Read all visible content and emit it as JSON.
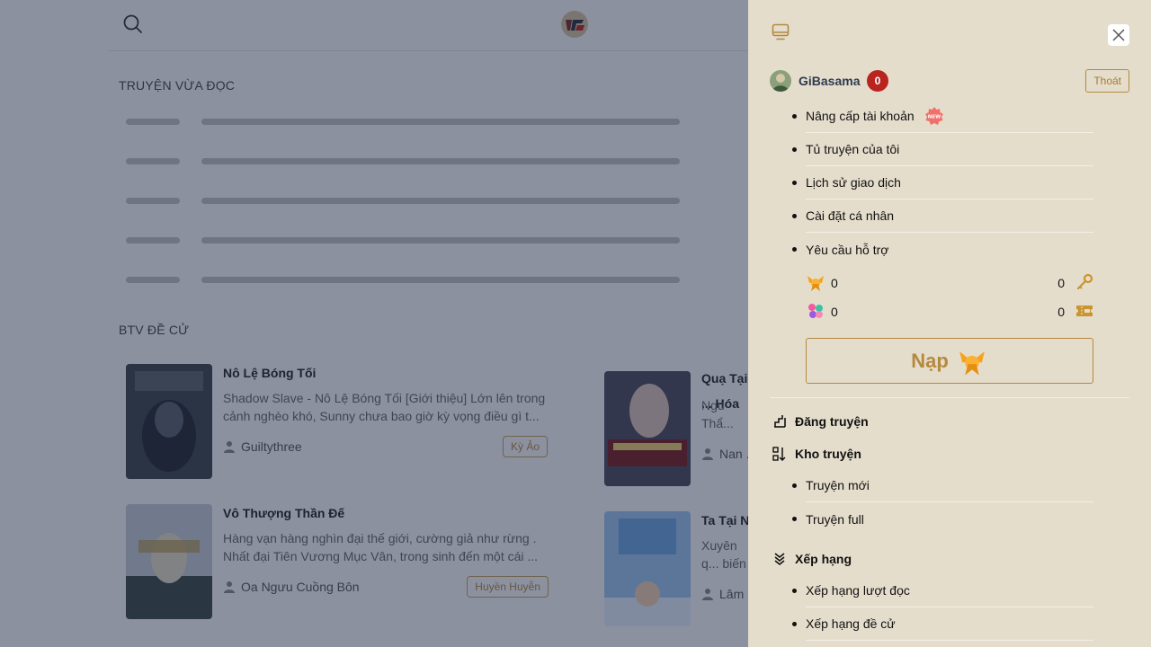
{
  "sections": {
    "recently_read": "TRUYỆN VỪA ĐỌC",
    "editor_picks": "BTV ĐỀ CỬ"
  },
  "books": [
    {
      "title": "Nô Lệ Bóng Tối",
      "description": "Shadow Slave - Nô Lệ Bóng Tối [Giới thiệu] Lớn lên trong cảnh nghèo khó, Sunny chưa bao giờ kỳ vọng điều gì t...",
      "author": "Guiltythree",
      "genre": "Kỳ Ảo"
    },
    {
      "title": "Vô Thượng Thần Đế",
      "description": "Hàng vạn hàng nghìn đại thế giới, cường giả như rừng . Nhất đại Tiên Vương Mục Vân, trong sinh đến một cái ...",
      "author": "Oa Ngưu Cuồng Bôn",
      "genre": "Huyền Huyễn"
    },
    {
      "title": "Quạ Tại ... Hóa",
      "description": "Ngu Thẩ... đen tình,...",
      "author": "Nan ...",
      "genre": ""
    },
    {
      "title": "Ta Tại N...",
      "description": "Xuyên q... biến thàn...",
      "author": "Lâm ...",
      "genre": ""
    }
  ],
  "drawer": {
    "username": "GiBasama",
    "notifications": "0",
    "logout": "Thoát",
    "account_menu": [
      "Nâng cấp tài khoản",
      "Tủ truyện của tôi",
      "Lịch sử giao dịch",
      "Cài đặt cá nhân",
      "Yêu cầu hỗ trợ"
    ],
    "wallet": {
      "candy": "0",
      "keys": "0",
      "flowers": "0",
      "tickets": "0"
    },
    "topup_label": "Nạp",
    "post_story": "Đăng truyện",
    "library": {
      "label": "Kho truyện",
      "items": [
        "Truyện mới",
        "Truyện full"
      ]
    },
    "ranking": {
      "label": "Xếp hạng",
      "items": [
        "Xếp hạng lượt đọc",
        "Xếp hạng đề cử"
      ]
    }
  },
  "colors": {
    "drawer_bg": "#e5ddcc",
    "accent_gold": "#b48a3e",
    "badge_red": "#b9241f",
    "overlay": "rgba(25,35,65,0.5)"
  }
}
